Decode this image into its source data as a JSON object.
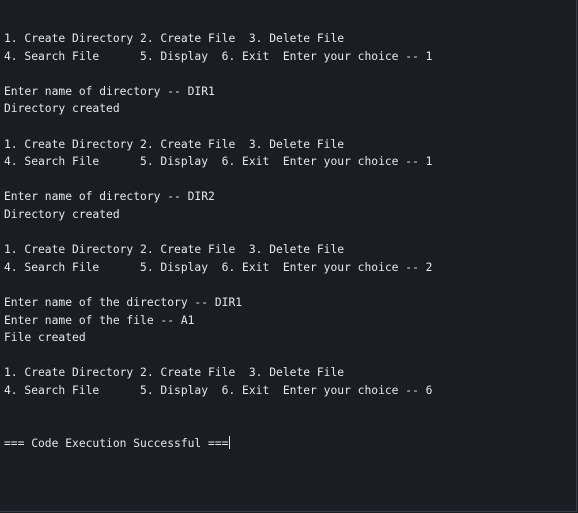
{
  "console": {
    "lines": [
      "1. Create Directory 2. Create File  3. Delete File",
      "4. Search File      5. Display  6. Exit  Enter your choice -- 1",
      "",
      "Enter name of directory -- DIR1",
      "Directory created",
      "",
      "1. Create Directory 2. Create File  3. Delete File",
      "4. Search File      5. Display  6. Exit  Enter your choice -- 1",
      "",
      "Enter name of directory -- DIR2",
      "Directory created",
      "",
      "1. Create Directory 2. Create File  3. Delete File",
      "4. Search File      5. Display  6. Exit  Enter your choice -- 2",
      "",
      "Enter name of the directory -- DIR1",
      "Enter name of the file -- A1",
      "File created",
      "",
      "1. Create Directory 2. Create File  3. Delete File",
      "4. Search File      5. Display  6. Exit  Enter your choice -- 6",
      "",
      "",
      "=== Code Execution Successful ==="
    ]
  },
  "colors": {
    "background": "#1b1c24",
    "text": "#e6e8ee"
  }
}
